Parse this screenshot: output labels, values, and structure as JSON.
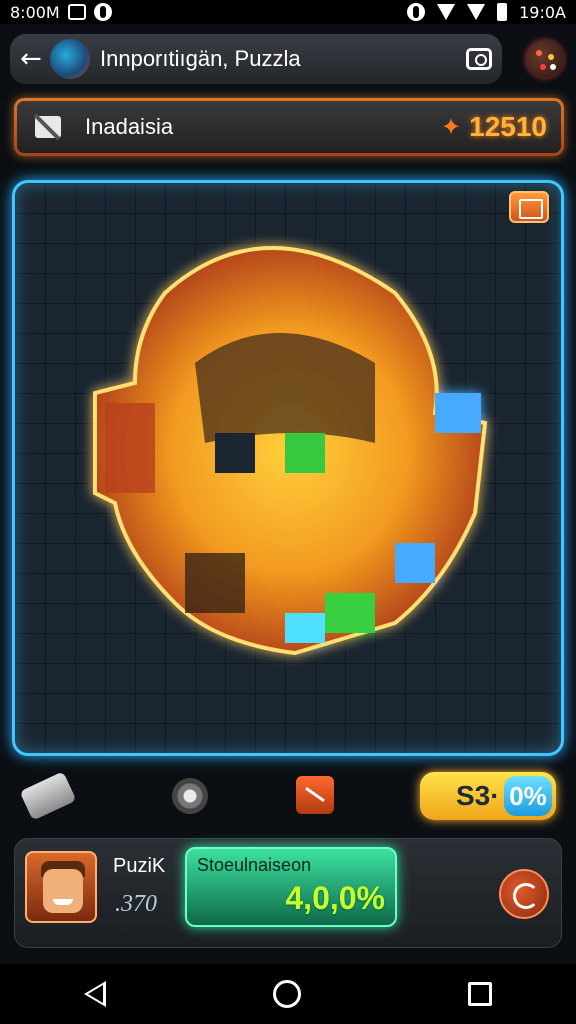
{
  "status_bar": {
    "time_left": "8:00M",
    "time_right": "19:0A"
  },
  "app_bar": {
    "title": "Innporıtiıgän, Puzzla"
  },
  "banner": {
    "title": "Inadaisia",
    "score": "12510"
  },
  "tools": {
    "pill_label": "S3·",
    "pill_percent": "0%"
  },
  "player": {
    "name": "PuziK",
    "points": ".370",
    "progress_label": "Stoeulnaiseon",
    "progress_value": "4,0,0%"
  },
  "colors": {
    "accent": "#41c7ff",
    "orange": "#e0772a",
    "green": "#3de0a0",
    "yellow": "#ffd23a"
  },
  "icons": [
    "back-arrow-icon",
    "camera-icon",
    "flag-icon",
    "spark-icon",
    "hint-icon",
    "eye-icon",
    "shuffle-icon",
    "refresh-icon",
    "nav-back-icon",
    "nav-home-icon",
    "nav-recent-icon"
  ]
}
